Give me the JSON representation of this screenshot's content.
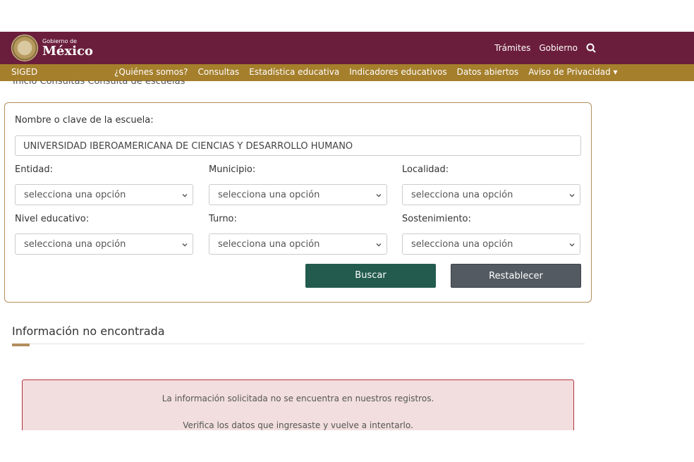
{
  "header": {
    "brand_small": "Gobierno de",
    "brand_big": "México",
    "links": [
      "Trámites",
      "Gobierno"
    ],
    "search_icon": "search-icon"
  },
  "subnav": {
    "title": "SIGED",
    "items": [
      "¿Quiénes somos?",
      "Consultas",
      "Estadística educativa",
      "Indicadores educativos",
      "Datos abiertos",
      "Aviso de Privacidad ▾"
    ]
  },
  "breadcrumb": "Inicio   Consultas   Consulta de escuelas",
  "form": {
    "name_label": "Nombre o clave de la escuela:",
    "name_value": "UNIVERSIDAD IBEROAMERICANA DE CIENCIAS Y DESARROLLO HUMANO",
    "entidad_label": "Entidad:",
    "municipio_label": "Municipio:",
    "localidad_label": "Localidad:",
    "nivel_label": "Nivel educativo:",
    "turno_label": "Turno:",
    "sostenimiento_label": "Sostenimiento:",
    "select_placeholder": "selecciona una opción",
    "search_button": "Buscar",
    "reset_button": "Restablecer"
  },
  "result": {
    "title": "Información no encontrada",
    "line1": "La información solicitada no se encuentra en nuestros registros.",
    "line2": "Verifica los datos que ingresaste y vuelve a intentarlo."
  },
  "colors": {
    "header": "#6b1e3b",
    "subnav": "#a57f2c",
    "search_button": "#235b4e",
    "reset_button": "#545a62",
    "alert_bg": "#f2dede",
    "alert_border": "#b23040"
  }
}
